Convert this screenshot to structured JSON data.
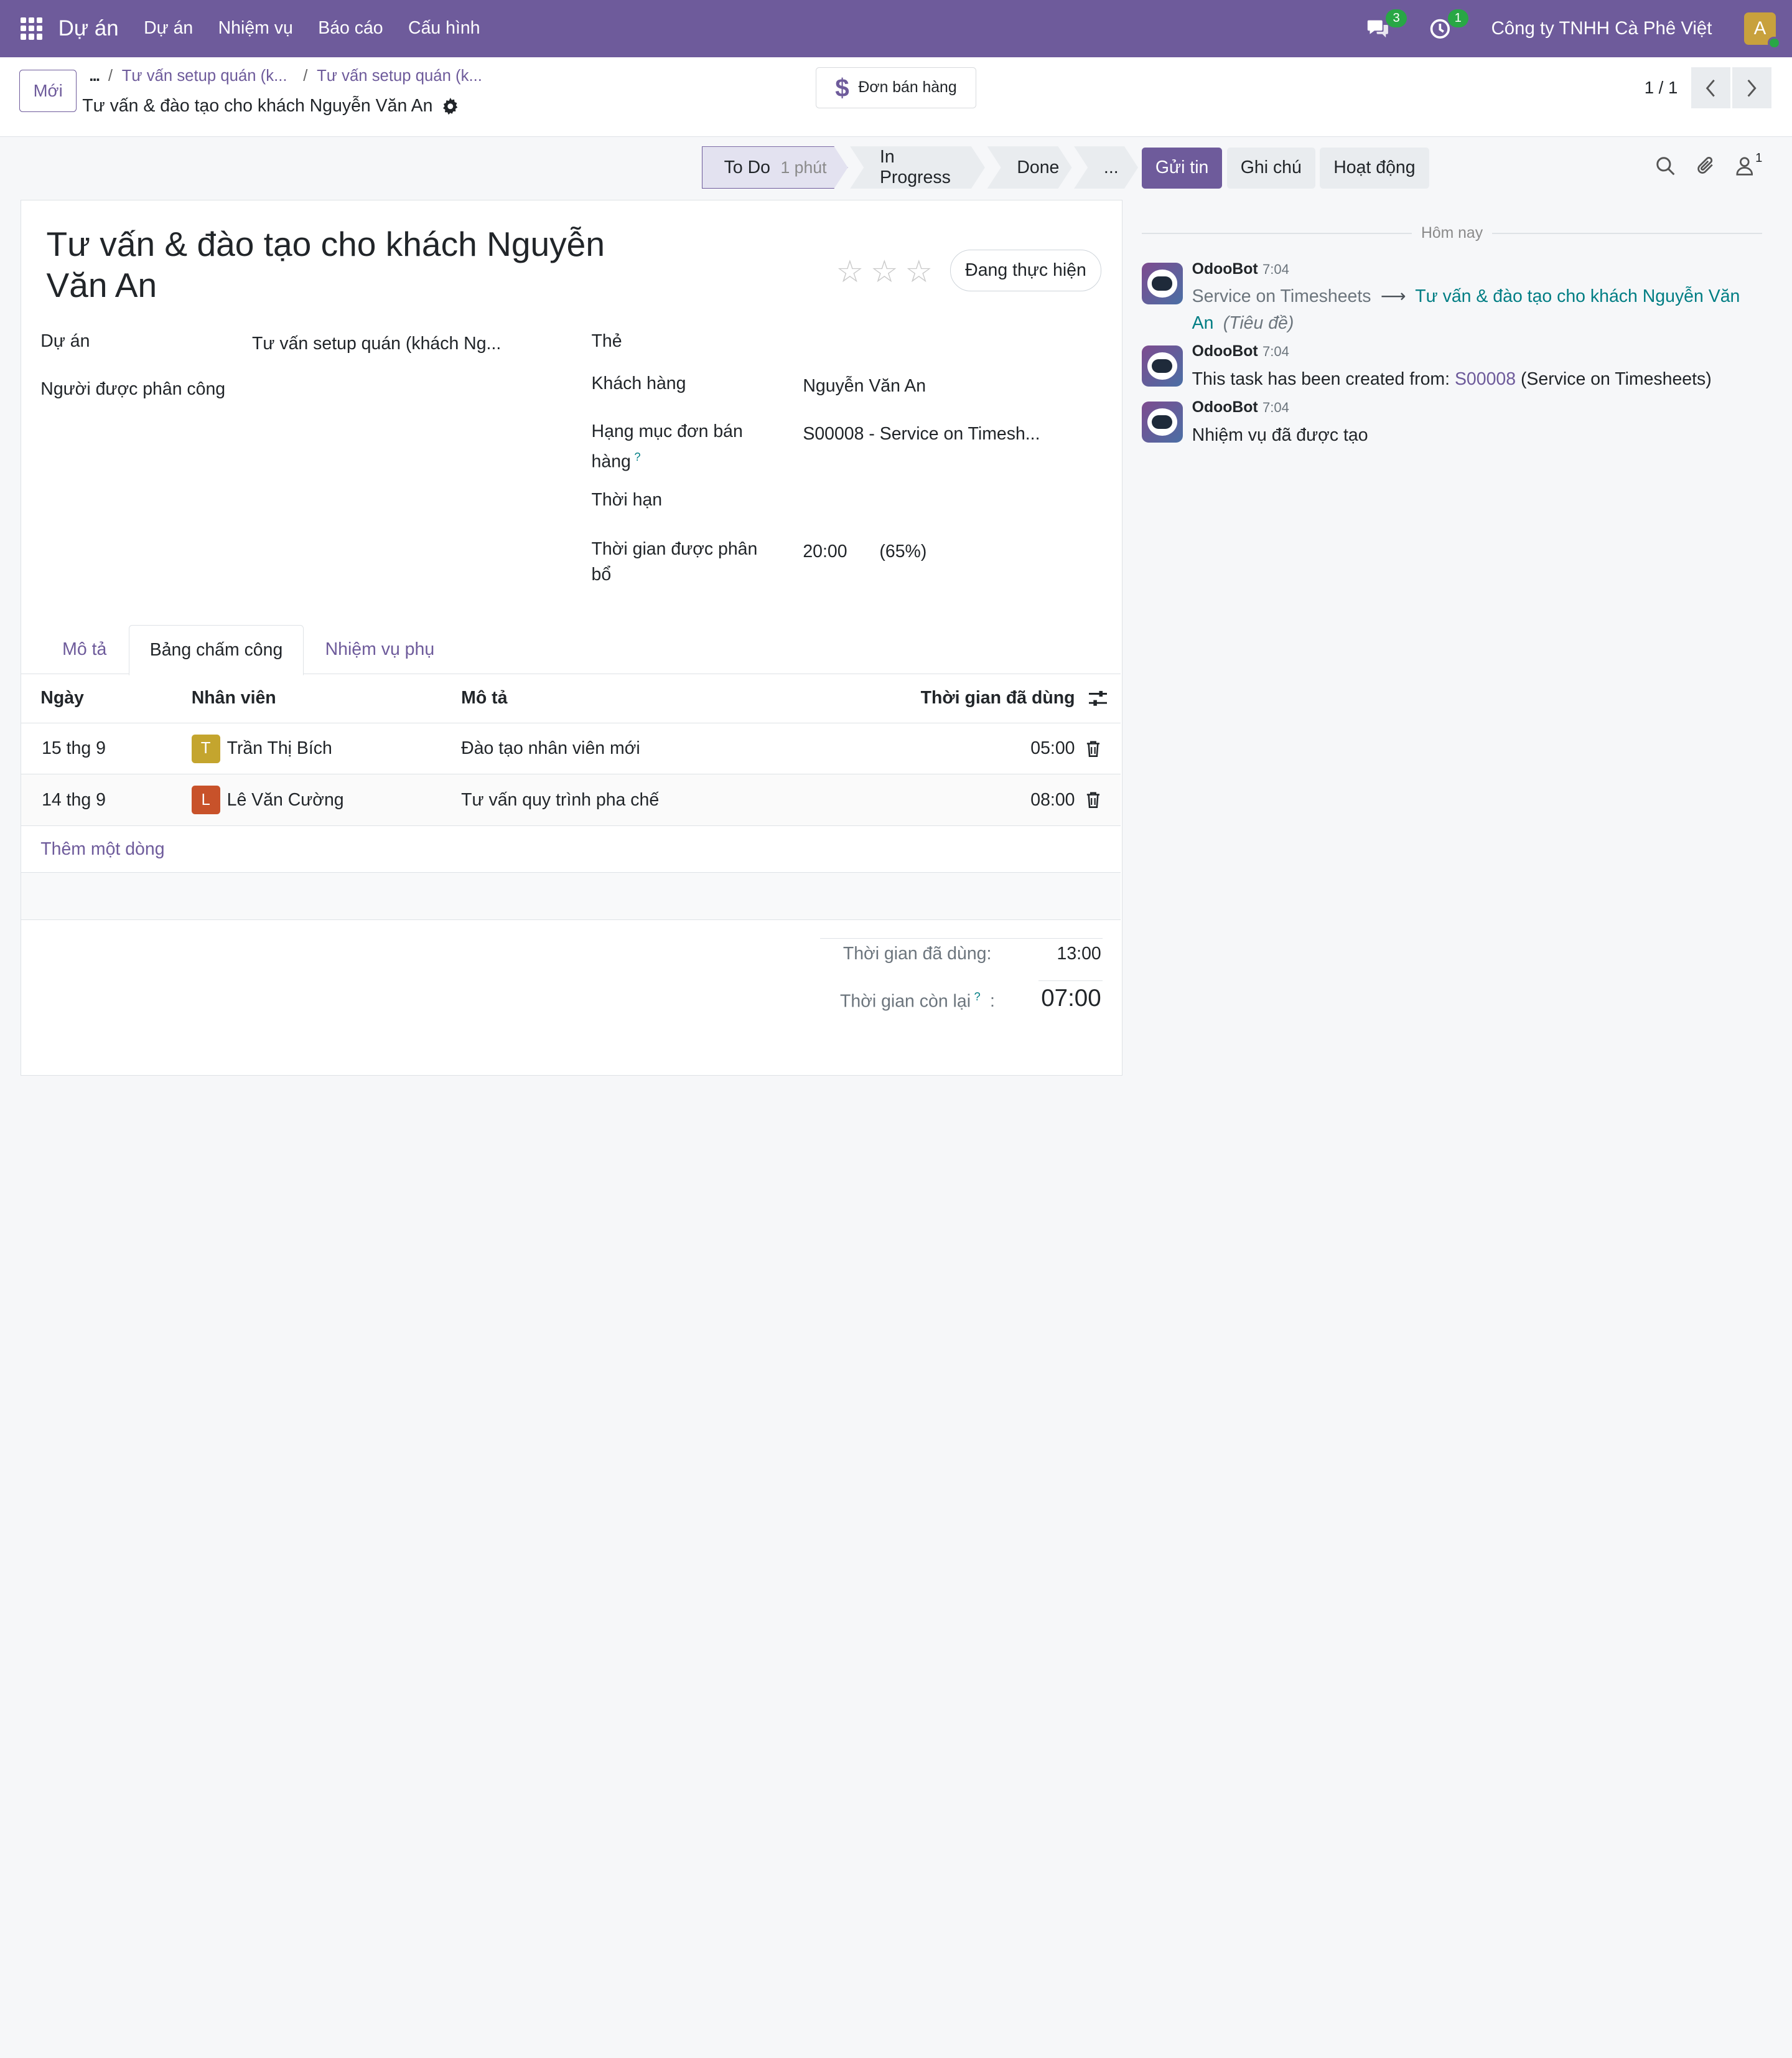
{
  "navbar": {
    "brand": "Dự án",
    "menu": [
      "Dự án",
      "Nhiệm vụ",
      "Báo cáo",
      "Cấu hình"
    ],
    "messages_count": "3",
    "activities_count": "1",
    "company": "Công ty TNHH Cà Phê Việt",
    "user_initial": "A"
  },
  "control": {
    "new_label": "Mới",
    "breadcrumb_dots": "...",
    "breadcrumbs": [
      "Tư vấn setup quán (k...",
      "Tư vấn setup quán (k..."
    ],
    "record_title": "Tư vấn & đào tạo cho khách Nguyễn Văn An",
    "sale_order_button": "Đơn bán hàng",
    "pager_value": "1 / 1"
  },
  "status_bar": {
    "stages": [
      {
        "label": "To Do",
        "duration": "1 phút"
      },
      {
        "label": "In Progress"
      },
      {
        "label": "Done"
      },
      {
        "label": "..."
      }
    ],
    "active_stage": "To Do"
  },
  "form": {
    "title": "Tư vấn & đào tạo cho khách Nguyễn Văn An",
    "priority_stars": 0,
    "state_button": "Đang thực hiện",
    "fields": {
      "project_label": "Dự án",
      "project_value": "Tư vấn setup quán (khách Ng...",
      "assignees_label": "Người được phân công",
      "tags_label": "Thẻ",
      "customer_label": "Khách hàng",
      "customer_value": "Nguyễn Văn An",
      "so_item_label_1": "Hạng mục đơn bán",
      "so_item_label_2": "hàng",
      "so_item_tooltip": "?",
      "so_item_value": "S00008 - Service on Timesh...",
      "deadline_label": "Thời hạn",
      "allocated_label_1": "Thời gian được phân",
      "allocated_label_2": "bổ",
      "allocated_value": "20:00",
      "allocated_percent": "(65%)"
    },
    "tabs": [
      "Mô tả",
      "Bảng chấm công",
      "Nhiệm vụ phụ"
    ],
    "active_tab": "Bảng chấm công",
    "timesheet": {
      "headers": {
        "date": "Ngày",
        "employee": "Nhân viên",
        "description": "Mô tả",
        "time_spent": "Thời gian đã dùng"
      },
      "rows": [
        {
          "date": "15 thg 9",
          "avatar": "T",
          "avatar_color": "#c4a52e",
          "employee": "Trần Thị Bích",
          "description": "Đào tạo nhân viên mới",
          "time": "05:00"
        },
        {
          "date": "14 thg 9",
          "avatar": "L",
          "avatar_color": "#c8522a",
          "employee": "Lê Văn Cường",
          "description": "Tư vấn quy trình pha chế",
          "time": "08:00"
        }
      ],
      "add_line": "Thêm một dòng"
    },
    "totals": {
      "spent_label": "Thời gian đã dùng:",
      "spent_value": "13:00",
      "remaining_label": "Thời gian còn lại",
      "remaining_tooltip": "?",
      "remaining_colon": ":",
      "remaining_value": "07:00"
    }
  },
  "chatter": {
    "buttons": [
      "Gửi tin",
      "Ghi chú",
      "Hoạt động"
    ],
    "followers_count": "1",
    "today": "Hôm nay",
    "messages": [
      {
        "author": "OdooBot",
        "time": "7:04",
        "old_value": "Service on Timesheets",
        "arrow": "⟶",
        "new_value": "Tư vấn & đào tạo cho khách Nguyễn Văn An",
        "field": "(Tiêu đề)"
      },
      {
        "author": "OdooBot",
        "time": "7:04",
        "text_before": "This task has been created from:",
        "link": "S00008",
        "text_after": "(Service on Timesheets)"
      },
      {
        "author": "OdooBot",
        "time": "7:04",
        "text": "Nhiệm vụ đã được tạo"
      }
    ]
  }
}
